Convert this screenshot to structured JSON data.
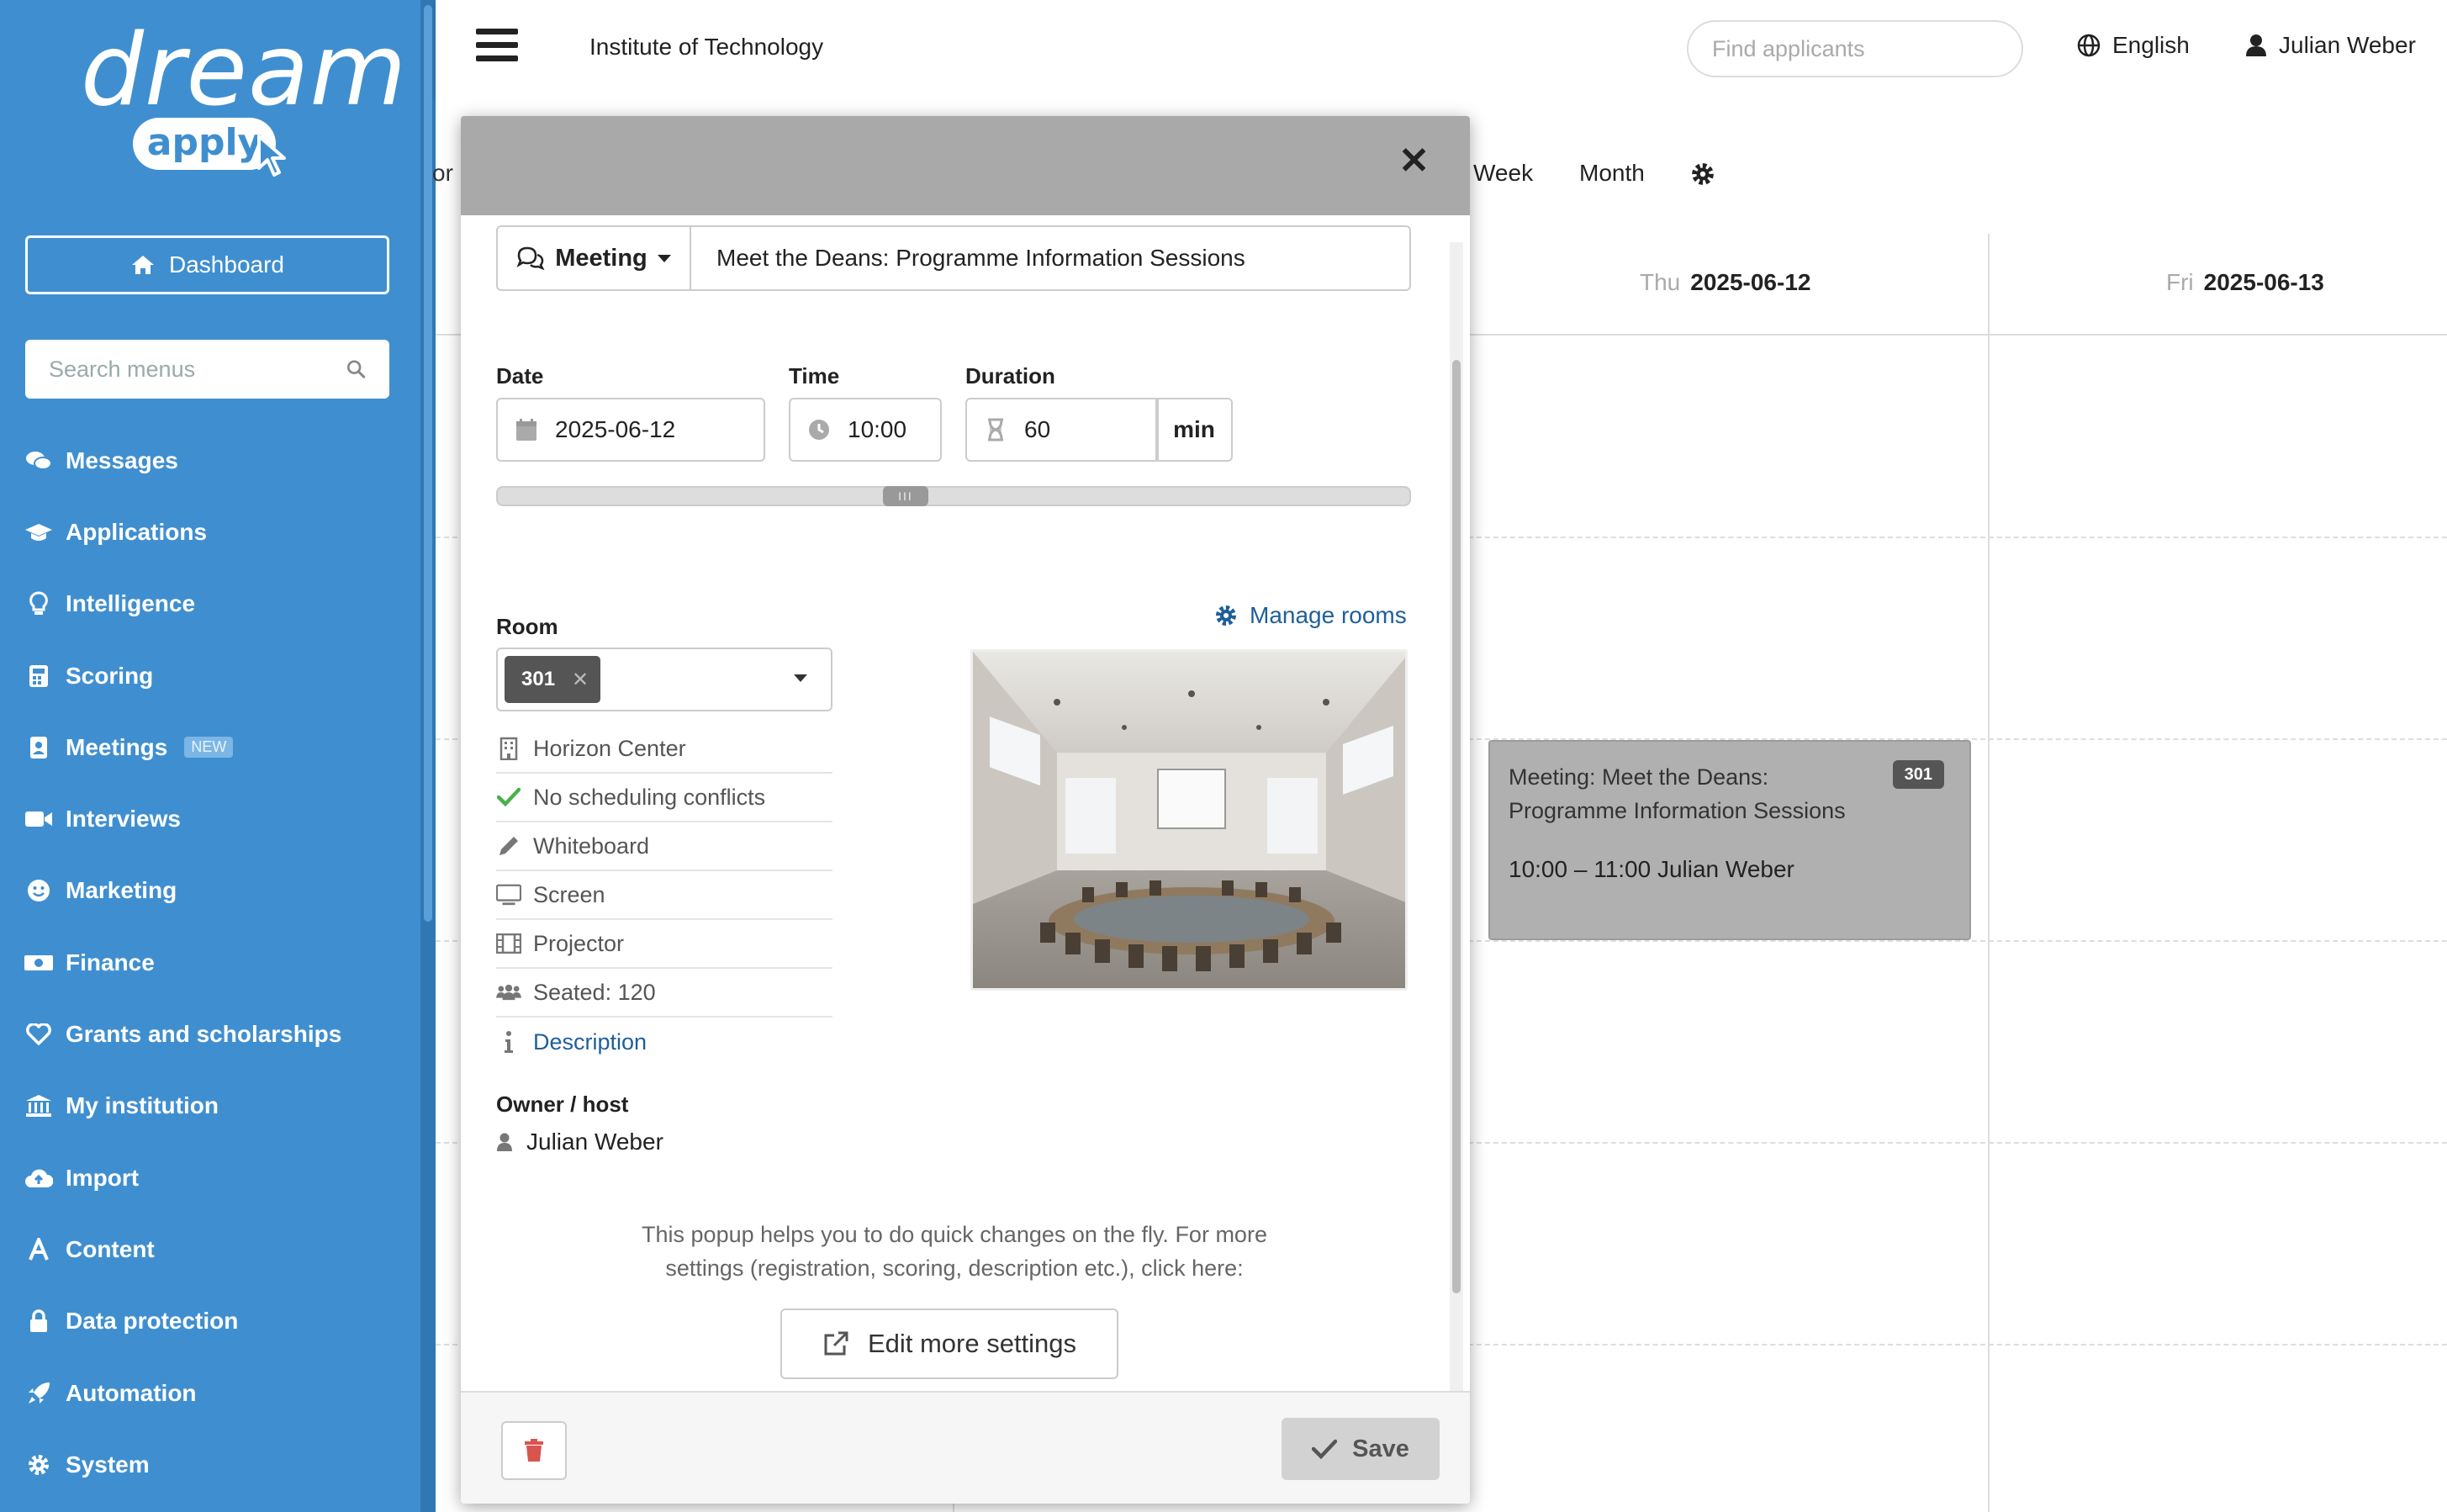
{
  "brand": {
    "word": "dream",
    "pill": "apply"
  },
  "sidebar": {
    "dashboard_label": "Dashboard",
    "search_placeholder": "Search menus",
    "items": [
      {
        "label": "Messages",
        "icon": "comments-icon"
      },
      {
        "label": "Applications",
        "icon": "graduation-cap-icon"
      },
      {
        "label": "Intelligence",
        "icon": "lightbulb-icon"
      },
      {
        "label": "Scoring",
        "icon": "calculator-icon"
      },
      {
        "label": "Meetings",
        "icon": "book-user-icon",
        "badge": "NEW"
      },
      {
        "label": "Interviews",
        "icon": "video-camera-icon"
      },
      {
        "label": "Marketing",
        "icon": "smiley-icon"
      },
      {
        "label": "Finance",
        "icon": "money-icon"
      },
      {
        "label": "Grants and scholarships",
        "icon": "heart-icon"
      },
      {
        "label": "My institution",
        "icon": "institution-icon"
      },
      {
        "label": "Import",
        "icon": "cloud-upload-icon"
      },
      {
        "label": "Content",
        "icon": "font-icon"
      },
      {
        "label": "Data protection",
        "icon": "lock-icon"
      },
      {
        "label": "Automation",
        "icon": "rocket-icon"
      },
      {
        "label": "System",
        "icon": "gear-icon"
      }
    ]
  },
  "topbar": {
    "institution": "Institute of Technology",
    "search_placeholder": "Find applicants",
    "language": "English",
    "user": "Julian Weber"
  },
  "calendar": {
    "partial_label": "or",
    "views": [
      "Week",
      "Month"
    ],
    "days": [
      {
        "dow": "Thu",
        "date": "2025-06-12"
      },
      {
        "dow": "Fri",
        "date": "2025-06-13"
      }
    ],
    "event": {
      "title": "Meeting: Meet the Deans: Programme Information Sessions",
      "room": "301",
      "time_host": "10:00 – 11:00 Julian Weber"
    }
  },
  "modal": {
    "type_label": "Meeting",
    "title_value": "Meet the Deans: Programme Information Sessions",
    "date_label": "Date",
    "date_value": "2025-06-12",
    "time_label": "Time",
    "time_value": "10:00",
    "duration_label": "Duration",
    "duration_value": "60",
    "duration_unit": "min",
    "slider_handle": "III",
    "room_label": "Room",
    "manage_rooms": "Manage rooms",
    "room_selected": "301",
    "room_props": [
      {
        "text": "Horizon Center",
        "icon": "building-icon"
      },
      {
        "text": "No scheduling conflicts",
        "icon": "check-icon"
      },
      {
        "text": "Whiteboard",
        "icon": "pencil-icon"
      },
      {
        "text": "Screen",
        "icon": "monitor-icon"
      },
      {
        "text": "Projector",
        "icon": "film-icon"
      },
      {
        "text": "Seated: 120",
        "icon": "users-icon"
      },
      {
        "text": "Description",
        "icon": "info-icon"
      }
    ],
    "owner_label": "Owner / host",
    "owner_value": "Julian Weber",
    "help_line1": "This popup helps you to do quick changes on the fly. For more",
    "help_line2": "settings (registration, scoring, description etc.), click here:",
    "edit_more": "Edit more settings",
    "save": "Save"
  },
  "colors": {
    "sidebar_bg": "#3f8fd0",
    "link": "#1f5f99",
    "check": "#4caf50",
    "delete": "#d9534f"
  }
}
